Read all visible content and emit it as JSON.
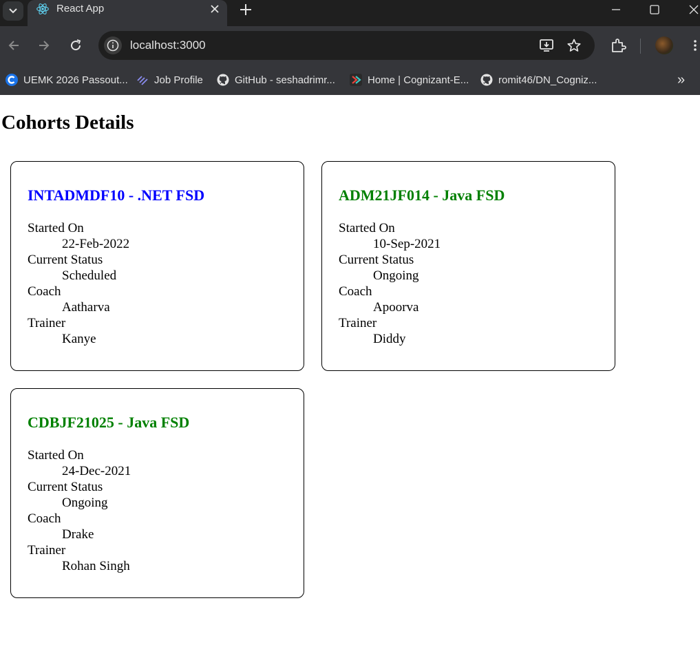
{
  "browser": {
    "tab_title": "React App",
    "url": "localhost:3000",
    "bookmarks": [
      {
        "label": "UEMK 2026 Passout...",
        "icon": "c-logo-icon"
      },
      {
        "label": "Job Profile",
        "icon": "layers-icon"
      },
      {
        "label": "GitHub - seshadrimr...",
        "icon": "github-icon"
      },
      {
        "label": "Home | Cognizant-E...",
        "icon": "cognizant-icon"
      },
      {
        "label": "romit46/DN_Cogniz...",
        "icon": "github-icon"
      }
    ],
    "overflow_label": "»"
  },
  "page": {
    "title": "Cohorts Details"
  },
  "colors": {
    "scheduled_title": "#0000ff",
    "ongoing_title": "#008000"
  },
  "cohorts": [
    {
      "title": "INTADMDF10 - .NET FSD",
      "title_color": "#0000ff",
      "started_label": "Started On",
      "started": "22-Feb-2022",
      "status_label": "Current Status",
      "status": "Scheduled",
      "coach_label": "Coach",
      "coach": "Aatharva",
      "trainer_label": "Trainer",
      "trainer": "Kanye"
    },
    {
      "title": "ADM21JF014 - Java FSD",
      "title_color": "#008000",
      "started_label": "Started On",
      "started": "10-Sep-2021",
      "status_label": "Current Status",
      "status": "Ongoing",
      "coach_label": "Coach",
      "coach": "Apoorva",
      "trainer_label": "Trainer",
      "trainer": "Diddy"
    },
    {
      "title": "CDBJF21025 - Java FSD",
      "title_color": "#008000",
      "started_label": "Started On",
      "started": "24-Dec-2021",
      "status_label": "Current Status",
      "status": "Ongoing",
      "coach_label": "Coach",
      "coach": "Drake",
      "trainer_label": "Trainer",
      "trainer": "Rohan Singh"
    }
  ]
}
